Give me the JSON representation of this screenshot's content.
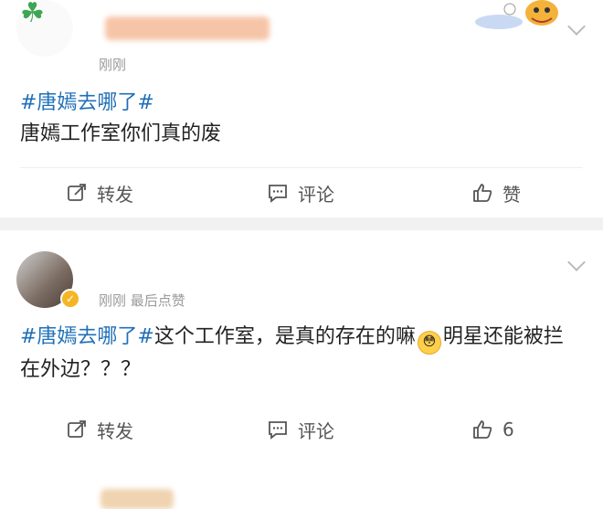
{
  "posts": [
    {
      "time": "刚刚",
      "hashtag": "#唐嫣去哪了#",
      "text": "唐嫣工作室你们真的废",
      "actions": {
        "repost": "转发",
        "comment": "评论",
        "like": "赞"
      }
    },
    {
      "time": "刚刚 最后点赞",
      "hashtag": "#唐嫣去哪了#",
      "text_before_emoji": "这个工作室，是真的存在的嘛",
      "emoji": "😳",
      "text_after_emoji": "明星还能被拦在外边？？？",
      "actions": {
        "repost": "转发",
        "comment": "评论",
        "like": "6"
      }
    }
  ],
  "colors": {
    "hashtag": "#1f6fb8",
    "meta": "#9a9a9a",
    "separator": "#f1f1f1"
  },
  "icons": [
    "clover-icon",
    "chevron-down-icon",
    "repost-icon",
    "comment-icon",
    "like-icon",
    "verified-badge-icon"
  ]
}
